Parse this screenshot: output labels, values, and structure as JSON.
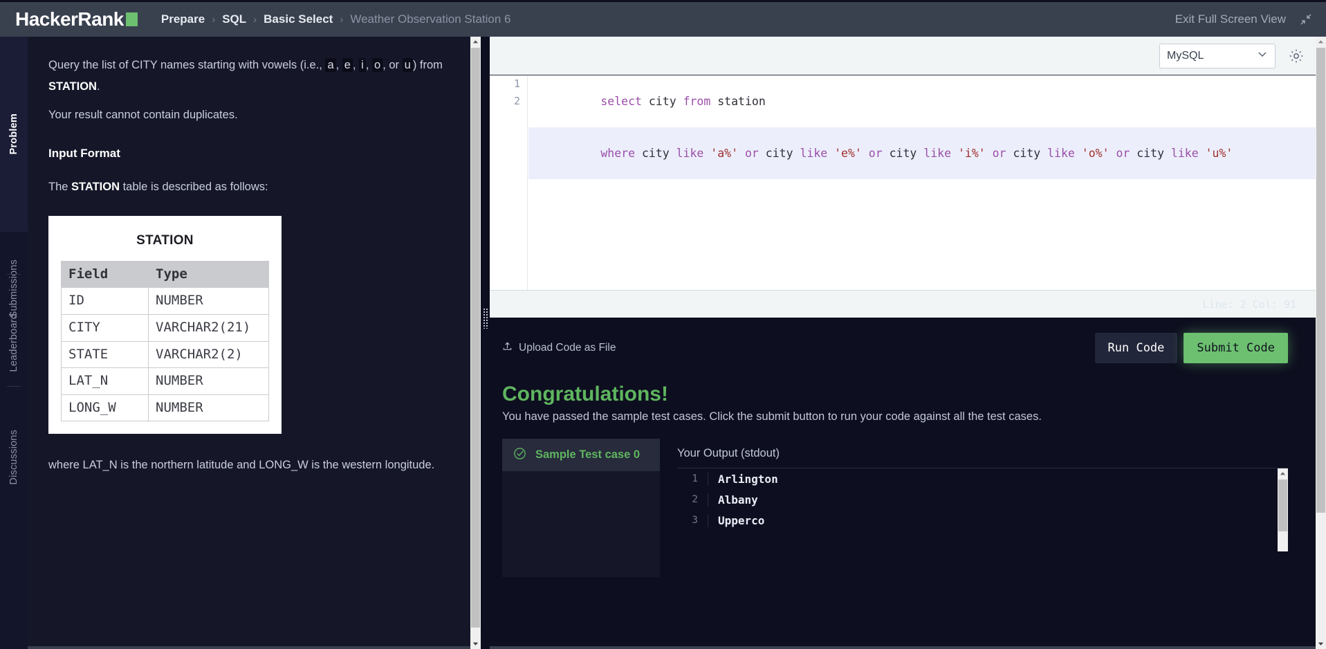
{
  "header": {
    "logo_text": "HackerRank",
    "breadcrumbs": [
      {
        "label": "Prepare",
        "dim": false
      },
      {
        "label": "SQL",
        "dim": false
      },
      {
        "label": "Basic Select",
        "dim": false
      },
      {
        "label": "Weather Observation Station 6",
        "dim": true
      }
    ],
    "separator": "›",
    "exit_label": "Exit Full Screen View",
    "accent_green": "#6cc070",
    "bar_color": "#39414f"
  },
  "rail": {
    "items": [
      {
        "label": "Problem",
        "active": true
      },
      {
        "label": "Submissions",
        "active": false
      },
      {
        "label": "Leaderboard",
        "active": false
      },
      {
        "label": "Discussions",
        "active": false
      }
    ]
  },
  "problem": {
    "line1_pre": "Query the list of CITY names starting with vowels (i.e., ",
    "vowels": [
      "a",
      "e",
      "i",
      "o",
      "u"
    ],
    "line1_mid": ", or ",
    "line1_post": ") from ",
    "line1_table": "STATION",
    "line1_end": ".",
    "line2": "Your result cannot contain duplicates.",
    "input_format_heading": "Input Format",
    "described_pre": "The ",
    "described_table": "STATION",
    "described_post": " table is described as follows:",
    "table": {
      "title": "STATION",
      "columns": [
        "Field",
        "Type"
      ],
      "rows": [
        [
          "ID",
          "NUMBER"
        ],
        [
          "CITY",
          "VARCHAR2(21)"
        ],
        [
          "STATE",
          "VARCHAR2(2)"
        ],
        [
          "LAT_N",
          "NUMBER"
        ],
        [
          "LONG_W",
          "NUMBER"
        ]
      ]
    },
    "footnote": "where LAT_N is the northern latitude and LONG_W is the western longitude."
  },
  "editor": {
    "language": "MySQL",
    "gear_icon": "gear-icon",
    "chevron_icon": "chevron-down-icon",
    "line_numbers": [
      "1",
      "2"
    ],
    "code_lines": [
      [
        {
          "t": "select ",
          "c": "kw"
        },
        {
          "t": "city ",
          "c": "id"
        },
        {
          "t": "from ",
          "c": "kw"
        },
        {
          "t": "station",
          "c": "id"
        }
      ],
      [
        {
          "t": "where ",
          "c": "kw"
        },
        {
          "t": "city ",
          "c": "id"
        },
        {
          "t": "like ",
          "c": "kw"
        },
        {
          "t": "'a%' ",
          "c": "str"
        },
        {
          "t": "or ",
          "c": "kw"
        },
        {
          "t": "city ",
          "c": "id"
        },
        {
          "t": "like ",
          "c": "kw"
        },
        {
          "t": "'e%' ",
          "c": "str"
        },
        {
          "t": "or ",
          "c": "kw"
        },
        {
          "t": "city ",
          "c": "id"
        },
        {
          "t": "like ",
          "c": "kw"
        },
        {
          "t": "'i%' ",
          "c": "str"
        },
        {
          "t": "or ",
          "c": "kw"
        },
        {
          "t": "city ",
          "c": "id"
        },
        {
          "t": "like ",
          "c": "kw"
        },
        {
          "t": "'o%' ",
          "c": "str"
        },
        {
          "t": "or ",
          "c": "kw"
        },
        {
          "t": "city ",
          "c": "id"
        },
        {
          "t": "like ",
          "c": "kw"
        },
        {
          "t": "'u%'",
          "c": "str"
        }
      ]
    ],
    "status": "Line: 2 Col: 91"
  },
  "actions": {
    "upload_label": "Upload Code as File",
    "upload_icon": "upload-icon",
    "run_label": "Run Code",
    "submit_label": "Submit Code"
  },
  "results": {
    "title": "Congratulations!",
    "subtitle": "You have passed the sample test cases. Click the submit button to run your code against all the test cases.",
    "testcases": [
      {
        "label": "Sample Test case 0",
        "status_icon": "check-circle-icon",
        "passed": true
      }
    ],
    "output_title": "Your Output (stdout)",
    "output_rows": [
      {
        "n": "1",
        "v": "Arlington"
      },
      {
        "n": "2",
        "v": "Albany"
      },
      {
        "n": "3",
        "v": "Upperco"
      }
    ]
  }
}
